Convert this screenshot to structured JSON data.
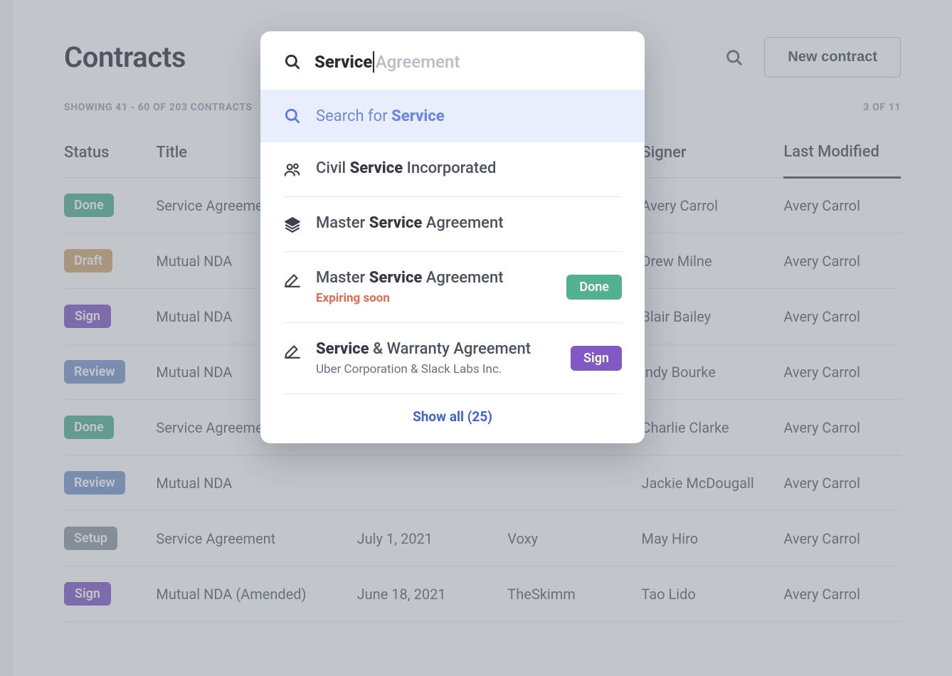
{
  "header": {
    "title": "Contracts",
    "new_button": "New contract",
    "showing_text": "SHOWING 41 - 60 OF 203 CONTRACTS",
    "page_text": "3 OF 11"
  },
  "columns": {
    "status": "Status",
    "title": "Title",
    "date": "",
    "party": "",
    "signer": "Signer",
    "modified": "Last Modified"
  },
  "rows": [
    {
      "status": "Done",
      "title": "Service Agreement",
      "date": "",
      "party": "",
      "signer": "Avery Carrol",
      "modified": "Avery Carrol"
    },
    {
      "status": "Draft",
      "title": "Mutual NDA",
      "date": "",
      "party": "",
      "signer": "Drew Milne",
      "modified": "Avery Carrol"
    },
    {
      "status": "Sign",
      "title": "Mutual NDA",
      "date": "",
      "party": "",
      "signer": "Blair Bailey",
      "modified": "Avery Carrol"
    },
    {
      "status": "Review",
      "title": "Mutual NDA",
      "date": "",
      "party": "",
      "signer": "Indy Bourke",
      "modified": "Avery Carrol"
    },
    {
      "status": "Done",
      "title": "Service Agreement",
      "date": "",
      "party": "",
      "signer": "Charlie Clarke",
      "modified": "Avery Carrol"
    },
    {
      "status": "Review",
      "title": "Mutual NDA",
      "date": "",
      "party": "",
      "signer": "Jackie McDougall",
      "modified": "Avery Carrol"
    },
    {
      "status": "Setup",
      "title": "Service Agreement",
      "date": "July 1, 2021",
      "party": "Voxy",
      "signer": "May Hiro",
      "modified": "Avery Carrol"
    },
    {
      "status": "Sign",
      "title": "Mutual NDA (Amended)",
      "date": "June 18, 2021",
      "party": "TheSkimm",
      "signer": "Tao Lido",
      "modified": "Avery Carrol"
    }
  ],
  "search": {
    "typed": "Service",
    "ghost": "Agreement",
    "search_for_prefix": "Search for ",
    "search_for_term": "Service",
    "show_all": "Show all (25)",
    "results": [
      {
        "icon": "people",
        "pre": "Civil ",
        "match": "Service",
        "post": " Incorporated"
      },
      {
        "icon": "layers",
        "pre": "Master ",
        "match": "Service",
        "post": " Agreement"
      },
      {
        "icon": "edit",
        "pre": "Master ",
        "match": "Service",
        "post": " Agreement",
        "sub": "Expiring soon",
        "sub_style": "warn",
        "badge": "Done"
      },
      {
        "icon": "edit",
        "pre": "",
        "match": "Service",
        "post": " & Warranty Agreement",
        "sub": "Uber Corporation & Slack Labs Inc.",
        "sub_style": "muted",
        "badge": "Sign"
      }
    ]
  }
}
